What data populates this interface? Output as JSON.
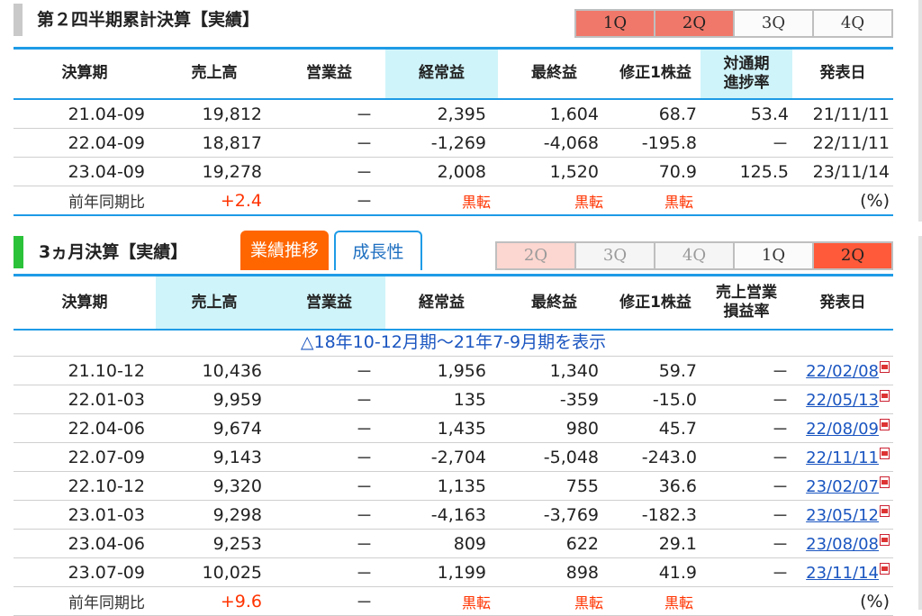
{
  "colors": {
    "accent_blue": "#1e9be6",
    "positive_red": "#ff3300",
    "tab_orange": "#ff6600",
    "header_highlight": "#cff4fa"
  },
  "cumulative": {
    "title": "第２四半期累計決算【実績】",
    "quarter_tabs": [
      "1Q",
      "2Q",
      "3Q",
      "4Q"
    ],
    "headers": [
      "決算期",
      "売上高",
      "営業益",
      "経常益",
      "最終益",
      "修正1株益",
      "対通期\n進捗率",
      "発表日"
    ],
    "rows": [
      {
        "period": "21.04-09",
        "sales": "19,812",
        "op": "－",
        "ord": "2,395",
        "net": "1,604",
        "eps": "68.7",
        "progress": "53.4",
        "date": "21/11/11"
      },
      {
        "period": "22.04-09",
        "sales": "18,817",
        "op": "－",
        "ord": "-1,269",
        "net": "-4,068",
        "eps": "-195.8",
        "progress": "－",
        "date": "22/11/11"
      },
      {
        "period": "23.04-09",
        "sales": "19,278",
        "op": "－",
        "ord": "2,008",
        "net": "1,520",
        "eps": "70.9",
        "progress": "125.5",
        "date": "23/11/14"
      }
    ],
    "yoy": {
      "label": "前年同期比",
      "sales": "+2.4",
      "op": "－",
      "ord": "黒転",
      "net": "黒転",
      "eps": "黒転",
      "unit": "(%)"
    }
  },
  "quarterly": {
    "title": "3ヵ月決算【実績】",
    "view_tabs": [
      "業績推移",
      "成長性"
    ],
    "quarter_tabs": [
      "2Q",
      "3Q",
      "4Q",
      "1Q",
      "2Q"
    ],
    "headers": [
      "決算期",
      "売上高",
      "営業益",
      "経常益",
      "最終益",
      "修正1株益",
      "売上営業\n損益率",
      "発表日"
    ],
    "show_more": "△18年10-12月期～21年7-9月期を表示",
    "rows": [
      {
        "period": "21.10-12",
        "sales": "10,436",
        "op": "－",
        "ord": "1,956",
        "net": "1,340",
        "eps": "59.7",
        "margin": "－",
        "date": "22/02/08"
      },
      {
        "period": "22.01-03",
        "sales": "9,959",
        "op": "－",
        "ord": "135",
        "net": "-359",
        "eps": "-15.0",
        "margin": "－",
        "date": "22/05/13"
      },
      {
        "period": "22.04-06",
        "sales": "9,674",
        "op": "－",
        "ord": "1,435",
        "net": "980",
        "eps": "45.7",
        "margin": "－",
        "date": "22/08/09"
      },
      {
        "period": "22.07-09",
        "sales": "9,143",
        "op": "－",
        "ord": "-2,704",
        "net": "-5,048",
        "eps": "-243.0",
        "margin": "－",
        "date": "22/11/11"
      },
      {
        "period": "22.10-12",
        "sales": "9,320",
        "op": "－",
        "ord": "1,135",
        "net": "755",
        "eps": "36.6",
        "margin": "－",
        "date": "23/02/07"
      },
      {
        "period": "23.01-03",
        "sales": "9,298",
        "op": "－",
        "ord": "-4,163",
        "net": "-3,769",
        "eps": "-182.3",
        "margin": "－",
        "date": "23/05/12"
      },
      {
        "period": "23.04-06",
        "sales": "9,253",
        "op": "－",
        "ord": "809",
        "net": "622",
        "eps": "29.1",
        "margin": "－",
        "date": "23/08/08"
      },
      {
        "period": "23.07-09",
        "sales": "10,025",
        "op": "－",
        "ord": "1,199",
        "net": "898",
        "eps": "41.9",
        "margin": "－",
        "date": "23/11/14"
      }
    ],
    "yoy": {
      "label": "前年同期比",
      "sales": "+9.6",
      "op": "－",
      "ord": "黒転",
      "net": "黒転",
      "eps": "黒転",
      "unit": "(%)"
    }
  }
}
